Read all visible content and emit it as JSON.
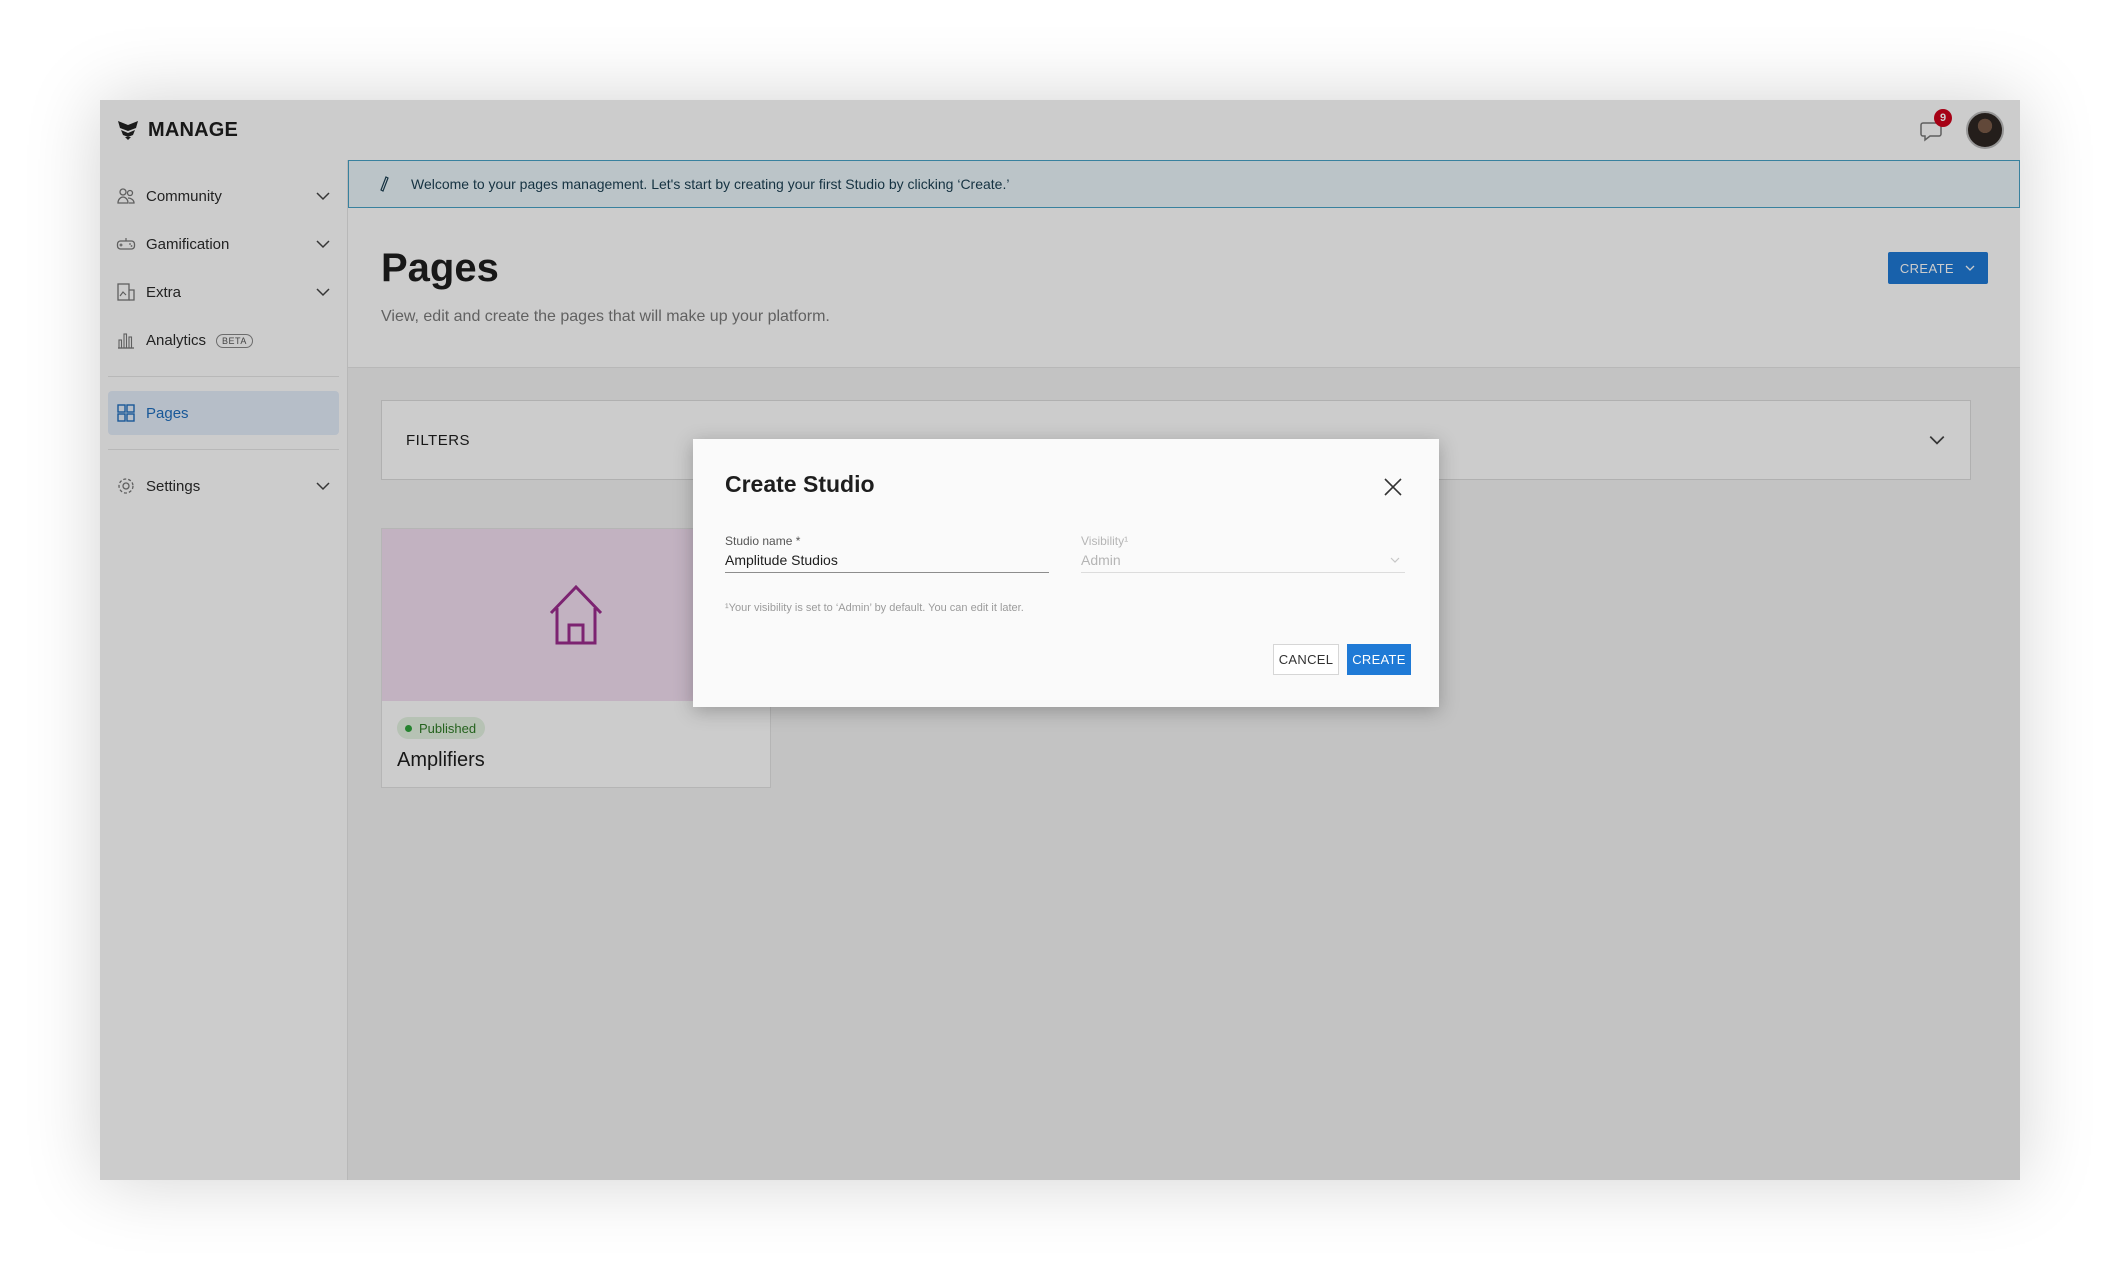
{
  "app": {
    "brand": "MANAGE",
    "logo_icon": "brand-logo-icon"
  },
  "header": {
    "notification_count": "9",
    "notification_icon": "chat-bubble-icon"
  },
  "sidebar": {
    "items": [
      {
        "label": "Community",
        "icon": "community-icon",
        "expandable": true
      },
      {
        "label": "Gamification",
        "icon": "gamepad-icon",
        "expandable": true
      },
      {
        "label": "Extra",
        "icon": "extra-icon",
        "expandable": true
      },
      {
        "label": "Analytics",
        "icon": "bar-chart-icon",
        "badge": "BETA"
      },
      {
        "label": "Pages",
        "icon": "grid-icon",
        "active": true
      },
      {
        "label": "Settings",
        "icon": "gear-icon",
        "expandable": true
      }
    ]
  },
  "banner": {
    "text": "Welcome to your pages management. Let's start by creating your first Studio by clicking ‘Create.’",
    "icon": "info-icon"
  },
  "page": {
    "title": "Pages",
    "subtitle": "View, edit and create the pages that will make up your platform.",
    "create_label": "CREATE"
  },
  "filters": {
    "label": "FILTERS"
  },
  "cards": [
    {
      "status": "Published",
      "title": "Amplifiers",
      "icon": "home-icon"
    }
  ],
  "modal": {
    "title": "Create Studio",
    "studio_name_label": "Studio name *",
    "studio_name_value": "Amplitude Studios",
    "visibility_label": "Visibility¹",
    "visibility_value": "Admin",
    "helper": "¹Your visibility is set to ‘Admin’ by default. You can edit it later.",
    "cancel_label": "CANCEL",
    "create_label": "CREATE"
  },
  "colors": {
    "accent": "#1f7ad6",
    "banner_bg": "#eaf6fb",
    "banner_border": "#47a2c6",
    "published": "#2fa43b",
    "card_thumb": "#f3dff2",
    "home_icon": "#9b2c8e",
    "notification": "#d0021b"
  }
}
